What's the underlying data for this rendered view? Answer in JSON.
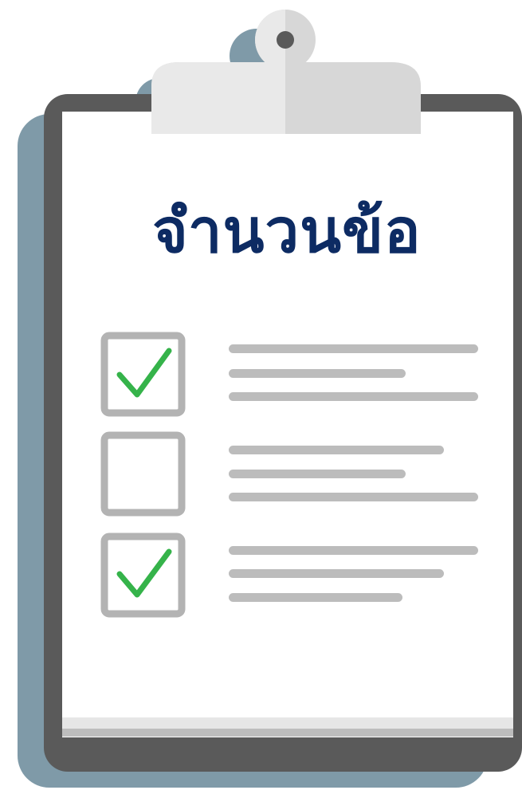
{
  "title": "จำนวนข้อ",
  "colors": {
    "title": "#0d2b63",
    "board_frame": "#5a5a5a",
    "board_shadow": "#7f9aa8",
    "paper": "#ffffff",
    "paper_edge": "#e6e6e6",
    "clip": "#d7d7d7",
    "clip_light": "#e9e9e9",
    "checkbox_border": "#b3b3b3",
    "check_mark": "#35b34a",
    "text_line": "#bcbcbc"
  },
  "checklist": [
    {
      "checked": true,
      "lines": 3
    },
    {
      "checked": false,
      "lines": 3
    },
    {
      "checked": true,
      "lines": 3
    }
  ],
  "icons": {
    "checked": "checkmark-icon",
    "clip": "clipboard-clip-icon"
  }
}
